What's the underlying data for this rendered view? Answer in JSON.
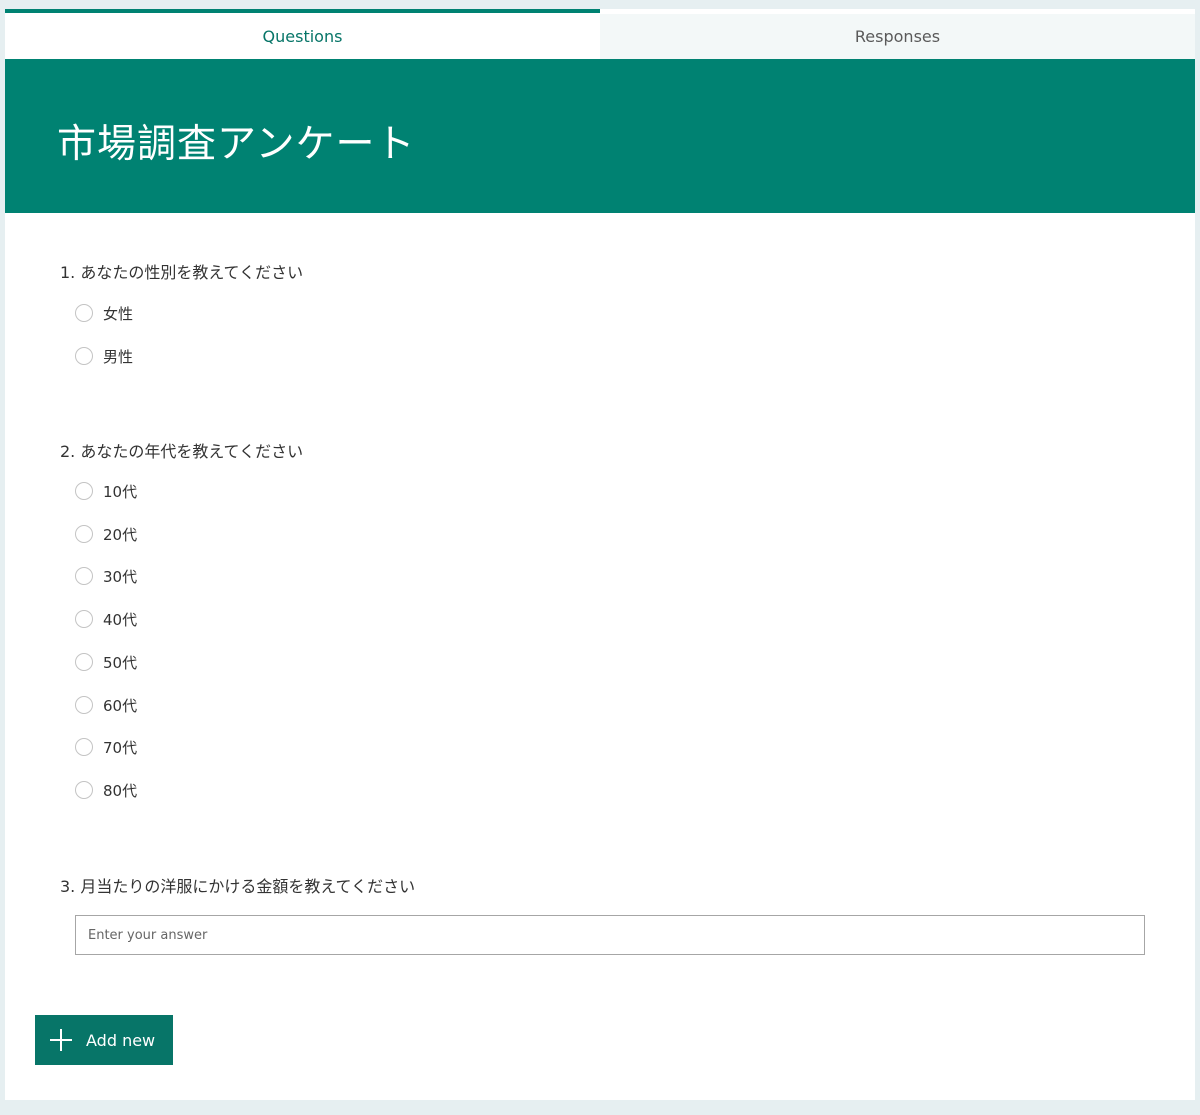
{
  "tabs": {
    "questions": "Questions",
    "responses": "Responses"
  },
  "form": {
    "title": "市場調査アンケート"
  },
  "questions": [
    {
      "label": "1. あなたの性別を教えてください",
      "options": [
        "女性",
        "男性"
      ]
    },
    {
      "label": "2. あなたの年代を教えてください",
      "options": [
        "10代",
        "20代",
        "30代",
        "40代",
        "50代",
        "60代",
        "70代",
        "80代"
      ]
    },
    {
      "label": "3. 月当たりの洋服にかける金額を教えてください",
      "placeholder": "Enter your answer"
    }
  ],
  "actions": {
    "add_new": "Add new"
  },
  "colors": {
    "accent": "#008272",
    "button": "#077568",
    "background": "#e6eff1"
  }
}
